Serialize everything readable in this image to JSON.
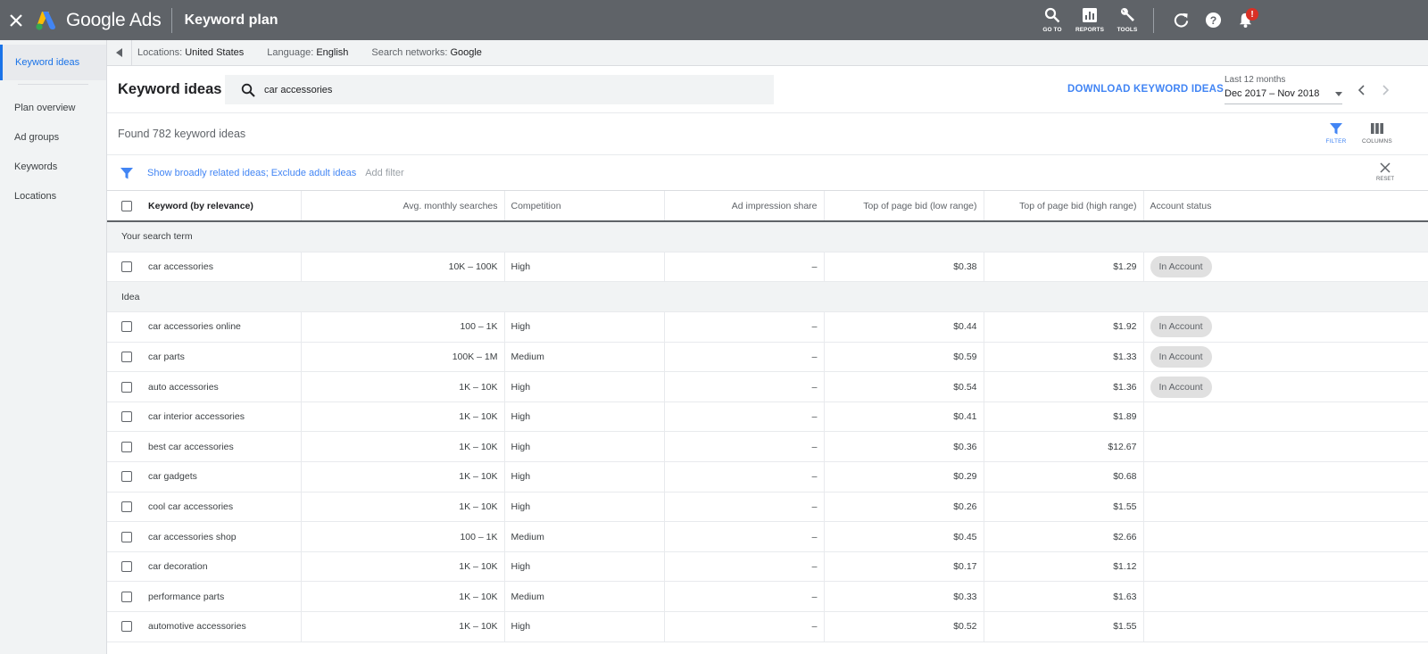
{
  "topbar": {
    "brand": "Google Ads",
    "title": "Keyword plan",
    "tools": [
      {
        "label": "GO TO",
        "icon": "search-icon"
      },
      {
        "label": "REPORTS",
        "icon": "reports-icon"
      },
      {
        "label": "TOOLS",
        "icon": "wrench-icon"
      }
    ],
    "notification_badge": "!"
  },
  "sidebar": {
    "items": [
      {
        "label": "Keyword ideas",
        "active": true
      },
      {
        "label": "Plan overview"
      },
      {
        "label": "Ad groups"
      },
      {
        "label": "Keywords"
      },
      {
        "label": "Locations"
      }
    ]
  },
  "locbar": {
    "locations_label": "Locations:",
    "locations_value": "United States",
    "language_label": "Language:",
    "language_value": "English",
    "networks_label": "Search networks:",
    "networks_value": "Google"
  },
  "header": {
    "title": "Keyword ideas",
    "search_value": "car accessories",
    "download_label": "DOWNLOAD KEYWORD IDEAS",
    "date_label": "Last 12 months",
    "date_value": "Dec 2017 – Nov 2018"
  },
  "results": {
    "found_text": "Found 782 keyword ideas",
    "filter_label": "FILTER",
    "columns_label": "COLUMNS"
  },
  "filterbar": {
    "filter_text": "Show broadly related ideas; Exclude adult ideas",
    "add_filter": "Add filter",
    "reset_label": "RESET"
  },
  "table": {
    "columns": [
      "Keyword (by relevance)",
      "Avg. monthly searches",
      "Competition",
      "Ad impression share",
      "Top of page bid (low range)",
      "Top of page bid (high range)",
      "Account status"
    ],
    "group_search_term": "Your search term",
    "group_idea": "Idea",
    "search_term_row": {
      "keyword": "car accessories",
      "avg": "10K – 100K",
      "comp": "High",
      "imp": "–",
      "low": "$0.38",
      "high": "$1.29",
      "status": "In Account"
    },
    "rows": [
      {
        "keyword": "car accessories online",
        "avg": "100 – 1K",
        "comp": "High",
        "imp": "–",
        "low": "$0.44",
        "high": "$1.92",
        "status": "In Account"
      },
      {
        "keyword": "car parts",
        "avg": "100K – 1M",
        "comp": "Medium",
        "imp": "–",
        "low": "$0.59",
        "high": "$1.33",
        "status": "In Account"
      },
      {
        "keyword": "auto accessories",
        "avg": "1K – 10K",
        "comp": "High",
        "imp": "–",
        "low": "$0.54",
        "high": "$1.36",
        "status": "In Account"
      },
      {
        "keyword": "car interior accessories",
        "avg": "1K – 10K",
        "comp": "High",
        "imp": "–",
        "low": "$0.41",
        "high": "$1.89",
        "status": ""
      },
      {
        "keyword": "best car accessories",
        "avg": "1K – 10K",
        "comp": "High",
        "imp": "–",
        "low": "$0.36",
        "high": "$12.67",
        "status": ""
      },
      {
        "keyword": "car gadgets",
        "avg": "1K – 10K",
        "comp": "High",
        "imp": "–",
        "low": "$0.29",
        "high": "$0.68",
        "status": ""
      },
      {
        "keyword": "cool car accessories",
        "avg": "1K – 10K",
        "comp": "High",
        "imp": "–",
        "low": "$0.26",
        "high": "$1.55",
        "status": ""
      },
      {
        "keyword": "car accessories shop",
        "avg": "100 – 1K",
        "comp": "Medium",
        "imp": "–",
        "low": "$0.45",
        "high": "$2.66",
        "status": ""
      },
      {
        "keyword": "car decoration",
        "avg": "1K – 10K",
        "comp": "High",
        "imp": "–",
        "low": "$0.17",
        "high": "$1.12",
        "status": ""
      },
      {
        "keyword": "performance parts",
        "avg": "1K – 10K",
        "comp": "Medium",
        "imp": "–",
        "low": "$0.33",
        "high": "$1.63",
        "status": ""
      },
      {
        "keyword": "automotive accessories",
        "avg": "1K – 10K",
        "comp": "High",
        "imp": "–",
        "low": "$0.52",
        "high": "$1.55",
        "status": ""
      }
    ]
  },
  "colors": {
    "topbar": "#5f6368",
    "accent": "#4285f4",
    "badge": "#d93025"
  }
}
